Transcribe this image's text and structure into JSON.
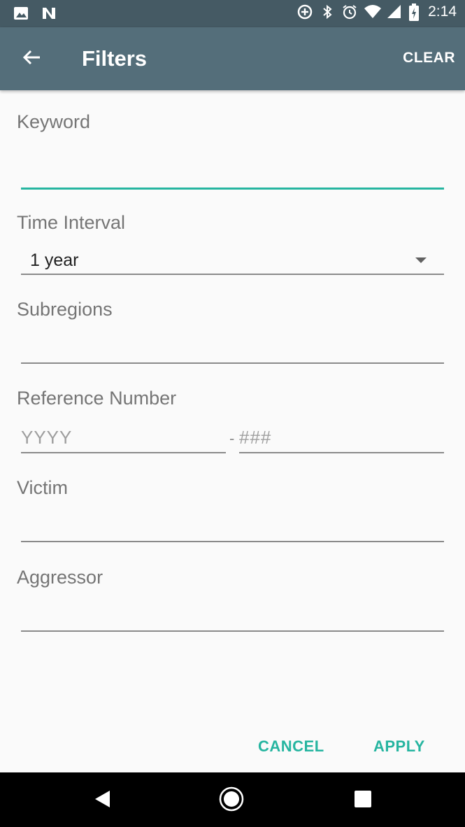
{
  "status_bar": {
    "time": "2:14",
    "icons_left": [
      "image-icon",
      "n-icon"
    ],
    "icons_right": [
      "data-saver-icon",
      "bluetooth-icon",
      "alarm-icon",
      "wifi-icon",
      "signal-icon",
      "battery-icon"
    ]
  },
  "app_bar": {
    "title": "Filters",
    "clear_label": "CLEAR",
    "background": "#546e7a"
  },
  "form": {
    "keyword": {
      "label": "Keyword",
      "value": ""
    },
    "time_interval": {
      "label": "Time Interval",
      "selected": "1 year"
    },
    "subregions": {
      "label": "Subregions",
      "value": ""
    },
    "reference_number": {
      "label": "Reference Number",
      "year_placeholder": "YYYY",
      "separator": "-",
      "number_placeholder": "###"
    },
    "victim": {
      "label": "Victim",
      "value": ""
    },
    "aggressor": {
      "label": "Aggressor",
      "value": ""
    }
  },
  "actions": {
    "cancel_label": "CANCEL",
    "apply_label": "APPLY",
    "accent": "#26b5a0"
  },
  "nav_bar": {
    "buttons": [
      "back-icon",
      "home-icon",
      "recents-icon"
    ]
  }
}
